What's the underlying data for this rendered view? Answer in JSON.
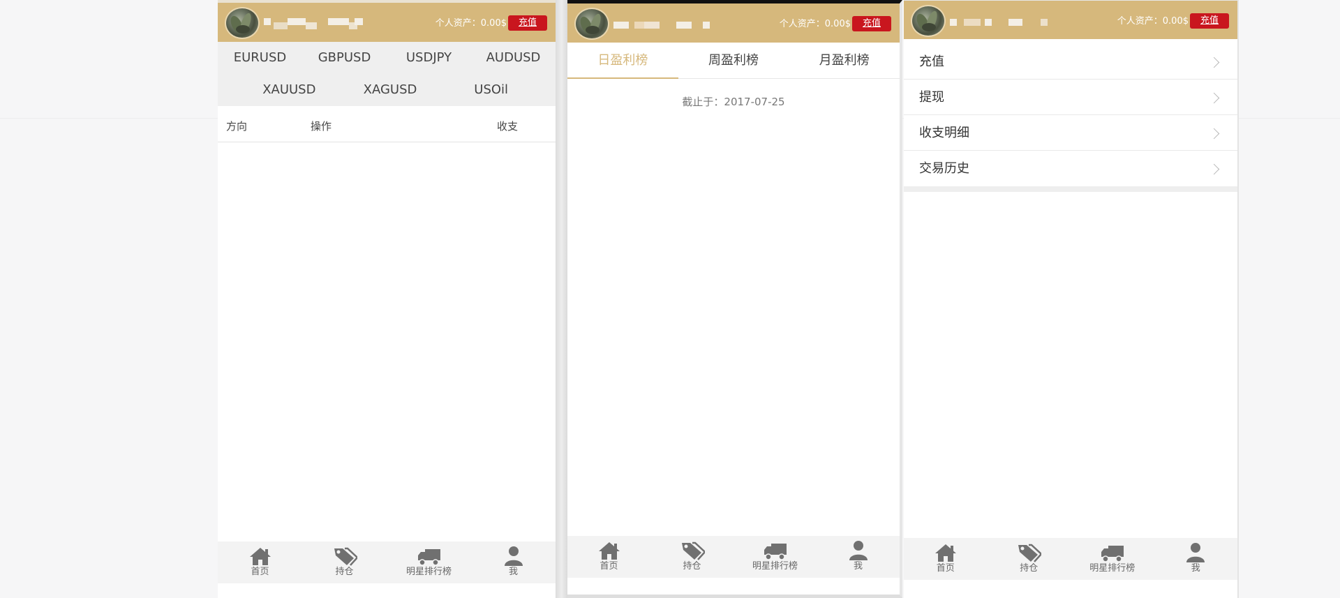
{
  "header": {
    "asset_label": "个人资产：0.00$",
    "recharge_label": "充值"
  },
  "phone1": {
    "symbols_row1": [
      "EURUSD",
      "GBPUSD",
      "USDJPY",
      "AUDUSD"
    ],
    "symbols_row2": [
      "XAUUSD",
      "XAGUSD",
      "USOil"
    ],
    "columns": {
      "direction": "方向",
      "action": "操作",
      "pnl": "收支"
    }
  },
  "phone2": {
    "tabs": [
      {
        "label": "日盈利榜",
        "active": true
      },
      {
        "label": "周盈利榜",
        "active": false
      },
      {
        "label": "月盈利榜",
        "active": false
      }
    ],
    "as_of": "截止于：2017-07-25"
  },
  "phone3": {
    "menu": [
      "充值",
      "提现",
      "收支明细",
      "交易历史"
    ]
  },
  "nav": {
    "items": [
      {
        "label": "首页",
        "icon": "home-icon"
      },
      {
        "label": "持仓",
        "icon": "tag-icon"
      },
      {
        "label": "明星排行榜",
        "icon": "truck-icon"
      },
      {
        "label": "我",
        "icon": "user-icon"
      }
    ]
  },
  "colors": {
    "header_bg": "#d6b87c",
    "recharge_button": "#c9161e",
    "active_tab": "#d6b87c",
    "nav_icon": "#707070"
  }
}
